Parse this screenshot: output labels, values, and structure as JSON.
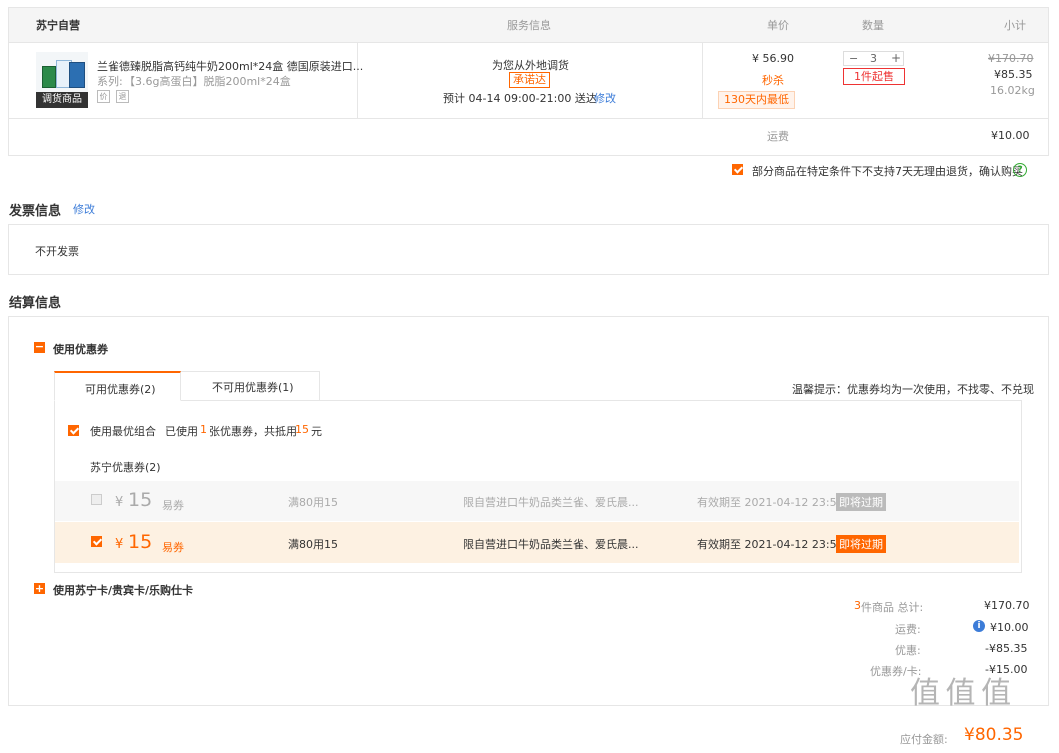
{
  "header": {
    "store": "苏宁自营",
    "service": "服务信息",
    "price": "单价",
    "qty": "数量",
    "subtotal": "小计"
  },
  "item": {
    "badge": "调货商品",
    "title": "兰雀德臻脱脂高钙纯牛奶200ml*24盒 德国原装进口...",
    "series_label": "系列:",
    "series_value": "【3.6g高蛋白】脱脂200ml*24盒",
    "icon1": "价",
    "icon2": "退",
    "service_line1": "为您从外地调货",
    "service_tag": "承诺达",
    "service_eta": "预计 04-14  09:00-21:00 送达",
    "service_edit": "修改",
    "price": "¥ 56.90",
    "price_tag1": "秒杀",
    "price_tag2": "130天内最低",
    "qty_minus": "−",
    "qty": "3",
    "qty_plus": "+",
    "qty_note": "1件起售",
    "orig_total": "¥170.70",
    "total": "¥85.35",
    "weight": "16.02kg"
  },
  "freight": {
    "label": "运费",
    "value": "¥10.00"
  },
  "notice": {
    "text": "部分商品在特定条件下不支持7天无理由退货，确认购买",
    "help": "?"
  },
  "invoice": {
    "title": "发票信息",
    "edit": "修改",
    "value": "不开发票"
  },
  "settlement": {
    "title": "结算信息",
    "coupon_toggle_icon": "−",
    "coupon_section": "使用优惠券",
    "tab_available": "可用优惠券(2)",
    "tab_unavailable": "不可用优惠券(1)",
    "tip": "温馨提示：优惠券均为一次使用，不找零、不兑现",
    "best_combo": "使用最优组合",
    "used_prefix": "已使用",
    "used_count": "1",
    "used_mid": "张优惠券，共抵用",
    "used_amount": "15",
    "used_suffix": "元",
    "group_title": "苏宁优惠券(2)",
    "coupons": [
      {
        "currency": "¥",
        "amount": "15",
        "kind": "易券",
        "rule": "满80用15",
        "scope": "限自营进口牛奶品类兰雀、爱氏晨...",
        "expiry": "有效期至 2021-04-12 23:59",
        "badge": "即将过期"
      },
      {
        "currency": "¥",
        "amount": "15",
        "kind": "易券",
        "rule": "满80用15",
        "scope": "限自营进口牛奶品类兰雀、爱氏晨...",
        "expiry": "有效期至 2021-04-12 23:59",
        "badge": "即将过期"
      }
    ],
    "card_toggle_icon": "+",
    "card_section": "使用苏宁卡/贵宾卡/乐购仕卡"
  },
  "summary": {
    "count": "3",
    "count_label": "件商品 总计:",
    "total": "¥170.70",
    "freight_label": "运费:",
    "freight_info": "i",
    "freight_value": "¥10.00",
    "discount_label": "优惠:",
    "discount_value": "-¥85.35",
    "coupon_label": "优惠券/卡:",
    "coupon_value": "-¥15.00",
    "payable_label": "应付金额:",
    "payable_value": "¥80.35"
  },
  "watermark": "值 值 值",
  "colors": {
    "accent": "#ff6600",
    "link": "#3c7cd8",
    "border": "#e6e6e6"
  }
}
